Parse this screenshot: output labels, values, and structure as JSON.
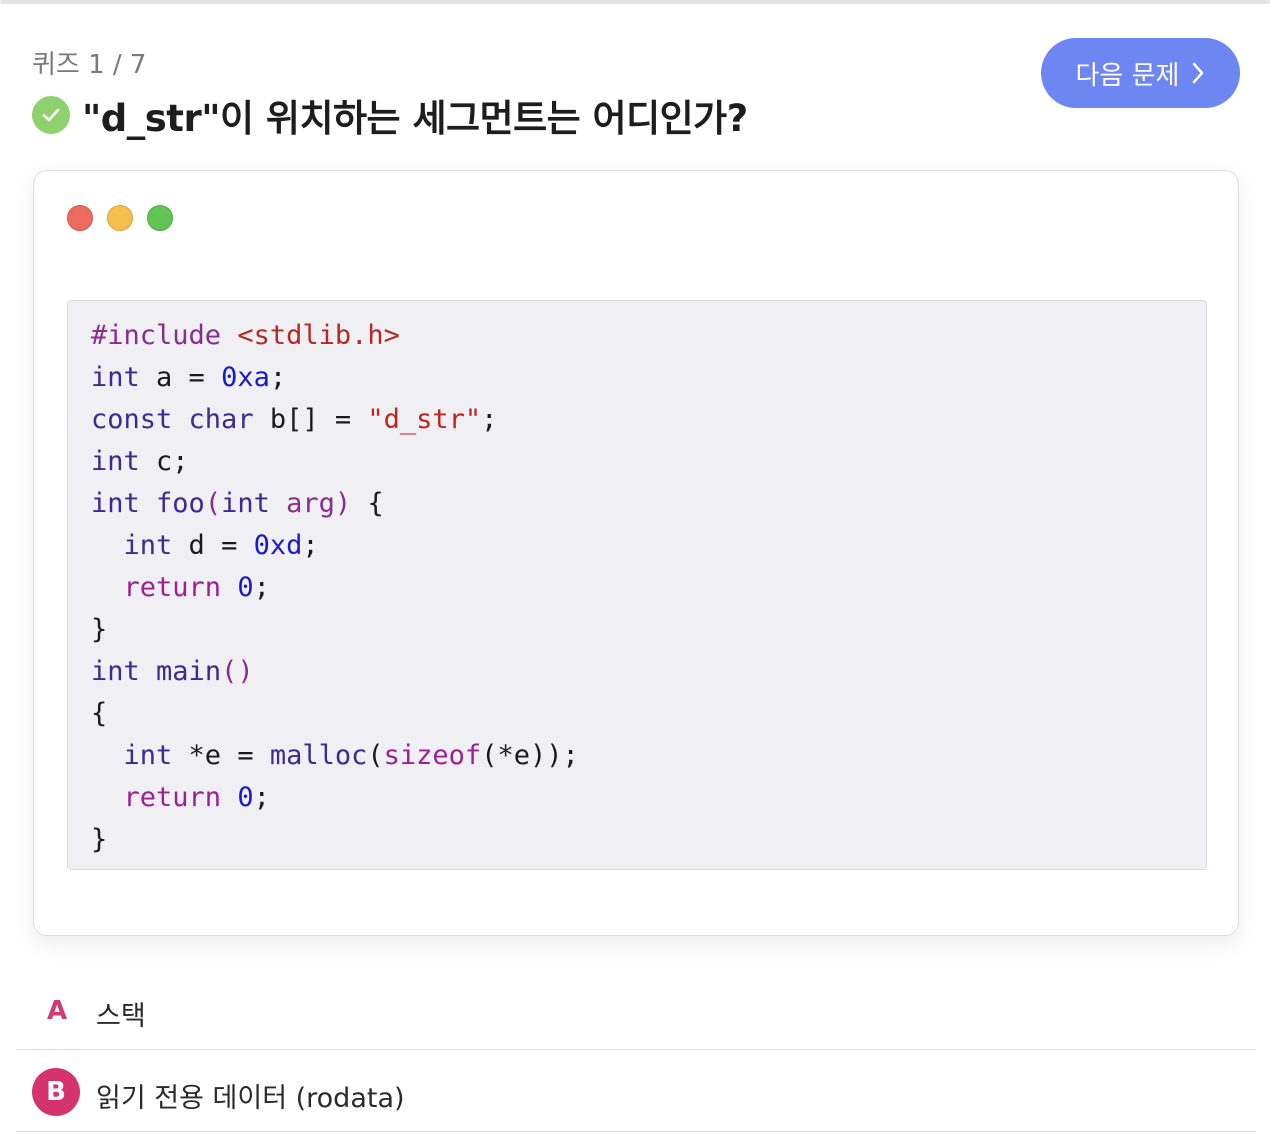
{
  "quiz": {
    "counter": "퀴즈 1 / 7",
    "title": "\"d_str\"이 위치하는 세그먼트는 어디인가?",
    "status_icon": "check-circle-icon"
  },
  "next_button": {
    "label": "다음 문제",
    "icon": "chevron-right-icon"
  },
  "window_controls": [
    "close-dot",
    "minimize-dot",
    "maximize-dot"
  ],
  "colors": {
    "accent_button": "#6e86f2",
    "check": "#8fd16d",
    "option_letter": "#d13a74",
    "selected_badge": "#d5336b",
    "code_bg": "#f0eff4"
  },
  "code": {
    "lines": [
      [
        {
          "t": "#include ",
          "c": "pp"
        },
        {
          "t": "<stdlib.h>",
          "c": "inc"
        }
      ],
      [
        {
          "t": "int",
          "c": "t"
        },
        {
          "t": " a = ",
          "c": ""
        },
        {
          "t": "0xa",
          "c": "num"
        },
        {
          "t": ";",
          "c": ""
        }
      ],
      [
        {
          "t": "const",
          "c": "t"
        },
        {
          "t": " ",
          "c": ""
        },
        {
          "t": "char",
          "c": "t"
        },
        {
          "t": " b[] = ",
          "c": ""
        },
        {
          "t": "\"d_str\"",
          "c": "str"
        },
        {
          "t": ";",
          "c": ""
        }
      ],
      [
        {
          "t": "int",
          "c": "t"
        },
        {
          "t": " c;",
          "c": ""
        }
      ],
      [
        {
          "t": "int",
          "c": "t"
        },
        {
          "t": " ",
          "c": ""
        },
        {
          "t": "foo",
          "c": "fn"
        },
        {
          "t": "(",
          "c": "pr"
        },
        {
          "t": "int",
          "c": "t"
        },
        {
          "t": " ",
          "c": ""
        },
        {
          "t": "arg",
          "c": "pr"
        },
        {
          "t": ")",
          "c": "pr"
        },
        {
          "t": " {",
          "c": ""
        }
      ],
      [
        {
          "t": "  ",
          "c": ""
        },
        {
          "t": "int",
          "c": "t"
        },
        {
          "t": " d = ",
          "c": ""
        },
        {
          "t": "0xd",
          "c": "num"
        },
        {
          "t": ";",
          "c": ""
        }
      ],
      [
        {
          "t": "  ",
          "c": ""
        },
        {
          "t": "return",
          "c": "kw"
        },
        {
          "t": " ",
          "c": ""
        },
        {
          "t": "0",
          "c": "num"
        },
        {
          "t": ";",
          "c": ""
        }
      ],
      [
        {
          "t": "}",
          "c": ""
        }
      ],
      [
        {
          "t": "int",
          "c": "t"
        },
        {
          "t": " ",
          "c": ""
        },
        {
          "t": "main",
          "c": "fn"
        },
        {
          "t": "()",
          "c": "pr"
        }
      ],
      [
        {
          "t": "{",
          "c": ""
        }
      ],
      [
        {
          "t": "  ",
          "c": ""
        },
        {
          "t": "int",
          "c": "t"
        },
        {
          "t": " *e = ",
          "c": ""
        },
        {
          "t": "malloc",
          "c": "t"
        },
        {
          "t": "(",
          "c": ""
        },
        {
          "t": "sizeof",
          "c": "kw"
        },
        {
          "t": "(*e));",
          "c": ""
        }
      ],
      [
        {
          "t": "  ",
          "c": ""
        },
        {
          "t": "return",
          "c": "kw"
        },
        {
          "t": " ",
          "c": ""
        },
        {
          "t": "0",
          "c": "num"
        },
        {
          "t": ";",
          "c": ""
        }
      ],
      [
        {
          "t": "}",
          "c": ""
        }
      ]
    ]
  },
  "options": [
    {
      "letter": "A",
      "text": "스택",
      "selected": false
    },
    {
      "letter": "B",
      "text": "읽기 전용 데이터 (rodata)",
      "selected": true
    }
  ]
}
